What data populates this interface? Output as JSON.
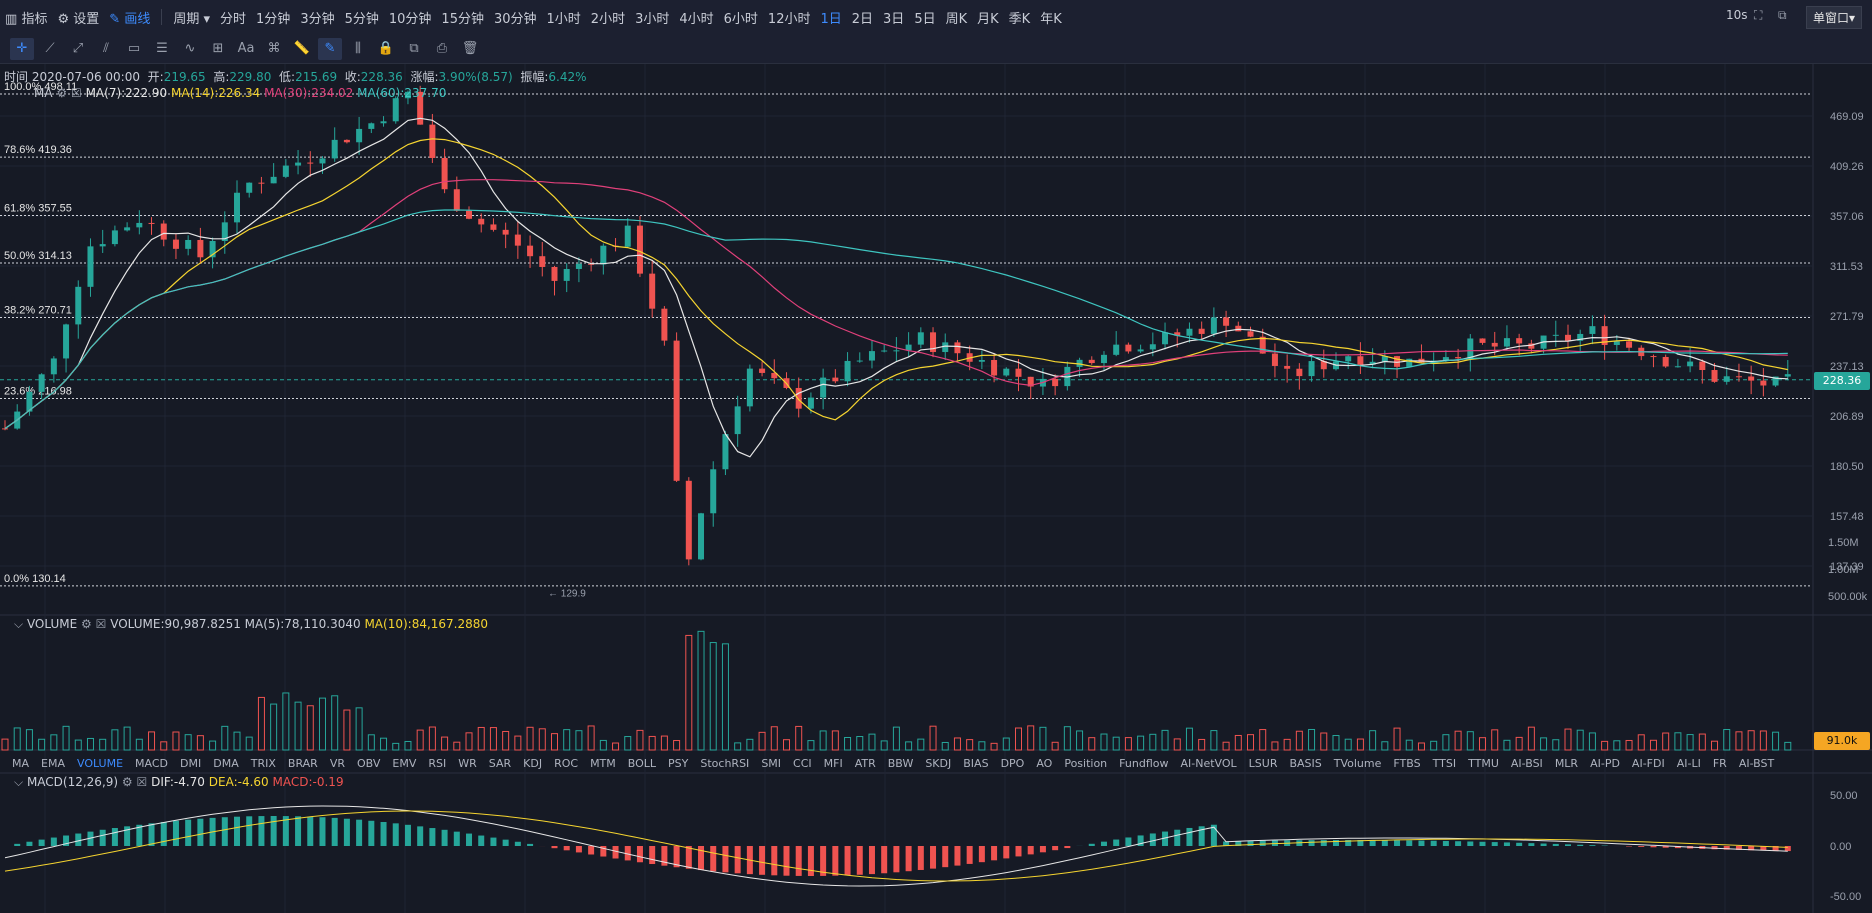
{
  "topbar": {
    "left": [
      {
        "icon": "indicator-icon",
        "label": "指标"
      },
      {
        "icon": "settings-icon",
        "label": "设置"
      },
      {
        "icon": "draw-icon",
        "label": "画线"
      }
    ],
    "period_label": "周期",
    "periods": [
      "分时",
      "1分钟",
      "3分钟",
      "5分钟",
      "10分钟",
      "15分钟",
      "30分钟",
      "1小时",
      "2小时",
      "3小时",
      "4小时",
      "6小时",
      "12小时",
      "1日",
      "2日",
      "3日",
      "5日",
      "周K",
      "月K",
      "季K",
      "年K"
    ],
    "active_period": "1日",
    "refresh": "10s",
    "window_mode": "单窗口"
  },
  "ohlc": {
    "time_label": "时间",
    "time": "2020-07-06 00:00",
    "open_label": "开",
    "open": "219.65",
    "high_label": "高",
    "high": "229.80",
    "low_label": "低",
    "low": "215.69",
    "close_label": "收",
    "close": "228.36",
    "change_label": "涨幅",
    "change": "3.90%(8.57)",
    "amp_label": "振幅",
    "amp": "6.42%"
  },
  "ma_legend": {
    "name": "MA",
    "ma7": "MA(7):222.90",
    "ma14": "MA(14):226.34",
    "ma30": "MA(30):234.02",
    "ma60": "MA(60):237.70"
  },
  "fib": [
    {
      "label": "100.0% 498.11",
      "price": 498.11
    },
    {
      "label": "78.6% 419.36",
      "price": 419.36
    },
    {
      "label": "61.8% 357.55",
      "price": 357.55
    },
    {
      "label": "50.0% 314.13",
      "price": 314.13
    },
    {
      "label": "38.2% 270.71",
      "price": 270.71
    },
    {
      "label": "23.6% 216.98",
      "price": 216.98
    },
    {
      "label": "0.0% 130.14",
      "price": 130.14
    }
  ],
  "price_axis": [
    "469.09",
    "409.26",
    "357.06",
    "311.53",
    "271.79",
    "237.13",
    "206.89",
    "180.50",
    "157.48",
    "137.39"
  ],
  "current_price": "228.36",
  "low_marker": "← 129.9",
  "volume_legend": {
    "name": "VOLUME",
    "volume": "VOLUME:90,987.8251",
    "ma5": "MA(5):78,110.3040",
    "ma10": "MA(10):84,167.2880"
  },
  "volume_axis": [
    "1.50M",
    "1.00M",
    "500.00k"
  ],
  "current_volume": "91.0k",
  "indicator_tabs": [
    "MA",
    "EMA",
    "VOLUME",
    "MACD",
    "DMI",
    "DMA",
    "TRIX",
    "BRAR",
    "VR",
    "OBV",
    "EMV",
    "RSI",
    "WR",
    "SAR",
    "KDJ",
    "ROC",
    "MTM",
    "BOLL",
    "PSY",
    "StochRSI",
    "SMI",
    "CCI",
    "MFI",
    "ATR",
    "BBW",
    "SKDJ",
    "BIAS",
    "DPO",
    "AO",
    "Position",
    "Fundflow",
    "AI-NetVOL",
    "LSUR",
    "BASIS",
    "TVolume",
    "FTBS",
    "TTSI",
    "TTMU",
    "AI-BSI",
    "MLR",
    "AI-PD",
    "AI-FDI",
    "AI-LI",
    "FR",
    "AI-BST"
  ],
  "active_tab": "VOLUME",
  "macd_legend": {
    "name": "MACD(12,26,9)",
    "dif": "DIF:-4.70",
    "dea": "DEA:-4.60",
    "macd": "MACD:-0.19"
  },
  "macd_axis": [
    "50.00",
    "0.00",
    "-50.00"
  ],
  "colors": {
    "up": "#26a69a",
    "down": "#ef5350",
    "ma7": "#e6e6e6",
    "ma14": "#f5d430",
    "ma30": "#e0407a",
    "ma60": "#3ec5c0",
    "accent": "#3d8bfd",
    "price_tag": "#26a69a",
    "vol_tag": "#f5a623"
  }
}
